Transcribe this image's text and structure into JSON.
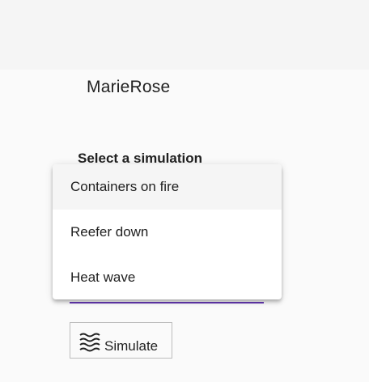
{
  "header": {
    "title": "MarieRose"
  },
  "simulation": {
    "label": "Select a simulation",
    "options": [
      "Containers on fire",
      "Reefer down",
      "Heat wave"
    ],
    "highlighted_option": "Containers on fire",
    "accent_color": "#673ab7"
  },
  "actions": {
    "simulate_label": "Simulate",
    "simulate_icon": "waves-icon"
  }
}
